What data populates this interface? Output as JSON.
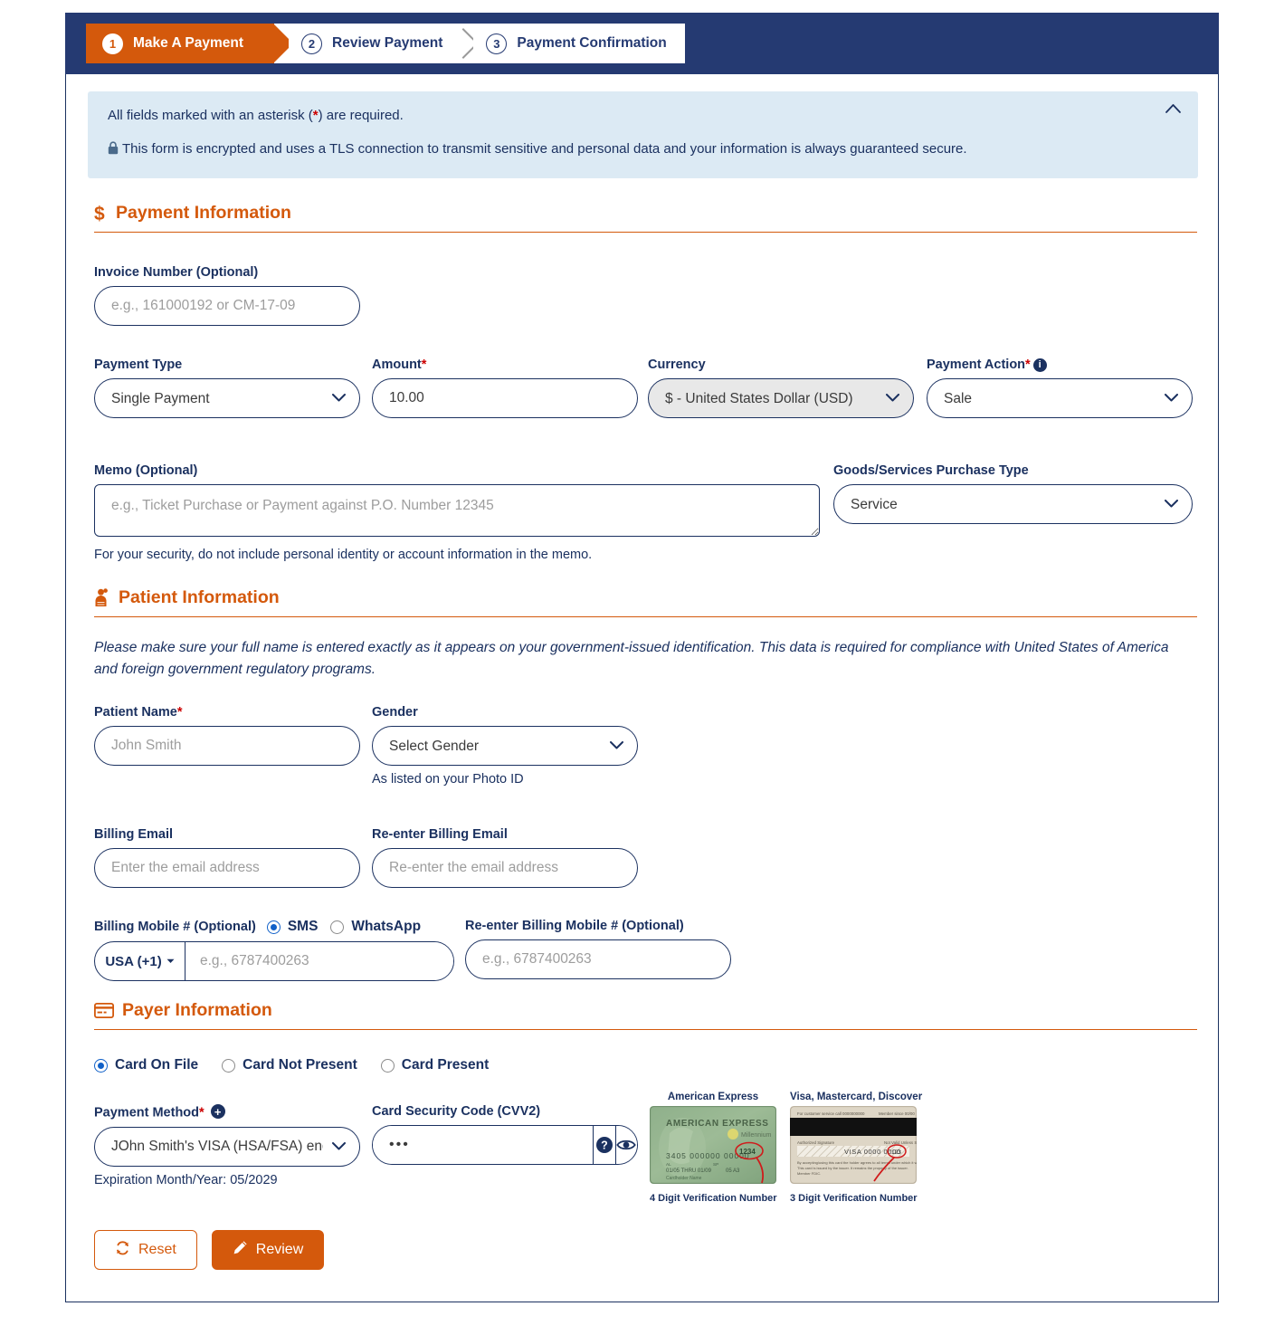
{
  "stepper": {
    "steps": [
      {
        "num": "1",
        "label": "Make A Payment"
      },
      {
        "num": "2",
        "label": "Review Payment"
      },
      {
        "num": "3",
        "label": "Payment Confirmation"
      }
    ]
  },
  "notice": {
    "required_text_pre": "All fields marked with an asterisk (",
    "required_star": "*",
    "required_text_post": ") are required.",
    "security_text": "This form is encrypted and uses a TLS connection to transmit sensitive and personal data and your information is always guaranteed secure.",
    "collapse_glyph": "⌃"
  },
  "payment_information": {
    "title": "Payment Information",
    "icon": "dollar-icon",
    "invoice": {
      "label": "Invoice Number (Optional)",
      "placeholder": "e.g., 161000192 or CM-17-09",
      "value": ""
    },
    "payment_type": {
      "label": "Payment Type",
      "value": "Single Payment",
      "options": [
        "Single Payment"
      ]
    },
    "amount": {
      "label": "Amount",
      "required": "*",
      "value": "10.00"
    },
    "currency": {
      "label": "Currency",
      "value": "$ - United States Dollar (USD)",
      "options": [
        "$ - United States Dollar (USD)"
      ],
      "disabled": true
    },
    "payment_action": {
      "label": "Payment Action",
      "required": "*",
      "info": "i",
      "value": "Sale",
      "options": [
        "Sale"
      ]
    },
    "memo": {
      "label": "Memo (Optional)",
      "placeholder": "e.g., Ticket Purchase or Payment against P.O. Number 12345",
      "value": "",
      "hint": "For your security, do not include personal identity or account information in the memo."
    },
    "purchase_type": {
      "label": "Goods/Services Purchase Type",
      "value": "Service",
      "options": [
        "Service"
      ]
    }
  },
  "patient_information": {
    "title": "Patient Information",
    "icon": "patient-icon",
    "note": "Please make sure your full name is entered exactly as it appears on your government-issued identification. This data is required for compliance with United States of America and foreign government regulatory programs.",
    "patient_name": {
      "label": "Patient Name",
      "required": "*",
      "placeholder": "John Smith",
      "value": ""
    },
    "gender": {
      "label": "Gender",
      "value": "Select Gender",
      "options": [
        "Select Gender"
      ],
      "hint": "As listed on your Photo ID"
    },
    "billing_email": {
      "label": "Billing Email",
      "placeholder": "Enter the email address",
      "value": ""
    },
    "reenter_billing_email": {
      "label": "Re-enter Billing Email",
      "placeholder": "Re-enter the email address",
      "value": ""
    },
    "billing_mobile": {
      "label": "Billing Mobile # (Optional)",
      "country_code": "USA (+1)",
      "placeholder": "e.g., 6787400263",
      "value": "",
      "channels": [
        {
          "label": "SMS",
          "selected": true
        },
        {
          "label": "WhatsApp",
          "selected": false
        }
      ]
    },
    "reenter_billing_mobile": {
      "label": "Re-enter Billing Mobile # (Optional)",
      "placeholder": "e.g., 6787400263",
      "value": ""
    }
  },
  "payer_information": {
    "title": "Payer Information",
    "icon": "credit-card-icon",
    "card_modes": [
      {
        "label": "Card On File",
        "selected": true
      },
      {
        "label": "Card Not Present",
        "selected": false
      },
      {
        "label": "Card Present",
        "selected": false
      }
    ],
    "payment_method": {
      "label": "Payment Method",
      "required": "*",
      "add_glyph": "+",
      "value": "JOhn Smith's VISA (HSA/FSA) end",
      "options": [
        "JOhn Smith's VISA (HSA/FSA) end"
      ],
      "expiration": "Expiration Month/Year: 05/2029"
    },
    "cvv": {
      "label": "Card Security Code (CVV2)",
      "value": "•••",
      "help_icon": "question-mark-icon",
      "reveal_icon": "eye-icon"
    },
    "card_art": {
      "amex": {
        "title": "American Express",
        "caption": "4 Digit Verification Number",
        "brand_text": "AMERICAN EXPRESS",
        "cvv_digits": "1234",
        "number_line": "3405 000000 00000",
        "sub_line": "01/05  THRU 01/09    05    A3",
        "millennium": "Millennium"
      },
      "visa": {
        "title": "Visa, Mastercard, Discover",
        "caption": "3 Digit Verification Number",
        "cvv_digits": "123",
        "signature_label": "Authorized Signature",
        "strip_text": "VISA 0000 0000 0000"
      }
    }
  },
  "actions": {
    "reset_label": "Reset",
    "review_label": "Review",
    "reset_icon": "refresh-icon",
    "review_icon": "pencil-icon"
  },
  "colors": {
    "navy": "#253a72",
    "navy_text": "#1b3160",
    "orange": "#d4590c",
    "notice_bg": "#dceaf4",
    "required_red": "#cc0000",
    "radio_blue": "#1060c8"
  }
}
